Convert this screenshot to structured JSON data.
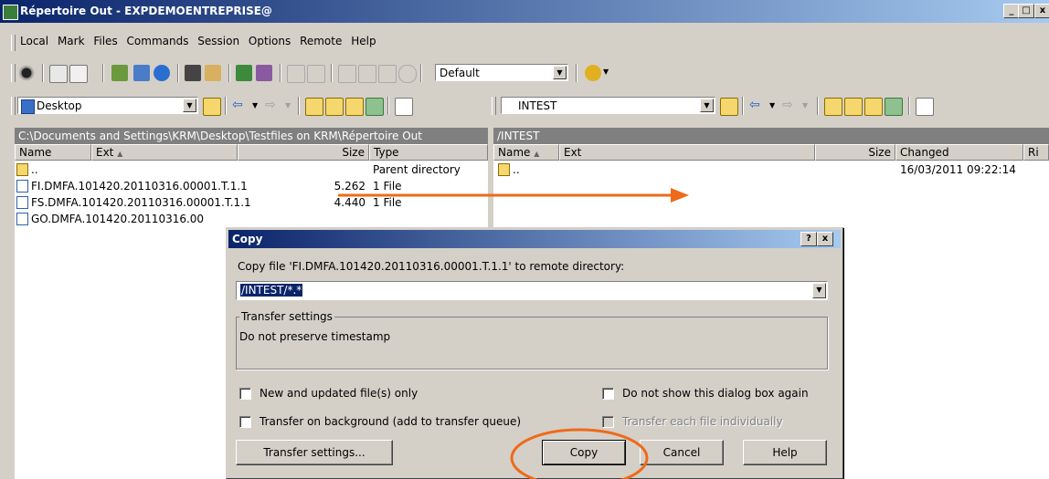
{
  "window": {
    "title": "Répertoire Out - EXPDEMOENTREPRISE@",
    "min_label": "_",
    "max_label": "□",
    "close_label": "x"
  },
  "menu": [
    "Local",
    "Mark",
    "Files",
    "Commands",
    "Session",
    "Options",
    "Remote",
    "Help"
  ],
  "toolbar": {
    "transfer_preset": "Default"
  },
  "left_panel": {
    "location": "Desktop",
    "path": "C:\\Documents and Settings\\KRM\\Desktop\\Testfiles on KRM\\Répertoire Out",
    "columns": {
      "name": "Name",
      "ext": "Ext",
      "size": "Size",
      "type": "Type"
    },
    "sort_indicator": "▲",
    "rows": [
      {
        "name": "..",
        "size": "",
        "type": "Parent directory"
      },
      {
        "name": "FI.DMFA.101420.20110316.00001.T.1.1",
        "size": "5.262",
        "type": "1 File"
      },
      {
        "name": "FS.DMFA.101420.20110316.00001.T.1.1",
        "size": "4.440",
        "type": "1 File"
      },
      {
        "name": "GO.DMFA.101420.20110316.00",
        "size": "",
        "type": ""
      }
    ]
  },
  "right_panel": {
    "location": "INTEST",
    "path": "/INTEST",
    "columns": {
      "name": "Name",
      "ext": "Ext",
      "size": "Size",
      "changed": "Changed",
      "rights": "Ri"
    },
    "sort_indicator": "▲",
    "rows": [
      {
        "name": "..",
        "changed": "16/03/2011 09:22:14"
      }
    ]
  },
  "dialog": {
    "title": "Copy",
    "help_btn": "?",
    "close_btn": "x",
    "prompt": "Copy file 'FI.DMFA.101420.20110316.00001.T.1.1' to remote directory:",
    "target_value": "/INTEST/*.*",
    "group_title": "Transfer settings",
    "group_text": "Do not preserve timestamp",
    "checkboxes": {
      "new_updated": "New and updated file(s) only",
      "background": "Transfer on background (add to transfer queue)",
      "dont_show": "Do not show this dialog box again",
      "individually": "Transfer each file individually"
    },
    "buttons": {
      "settings": "Transfer settings...",
      "copy": "Copy",
      "cancel": "Cancel",
      "help": "Help"
    }
  },
  "annotation_color": "#ee6a1a"
}
